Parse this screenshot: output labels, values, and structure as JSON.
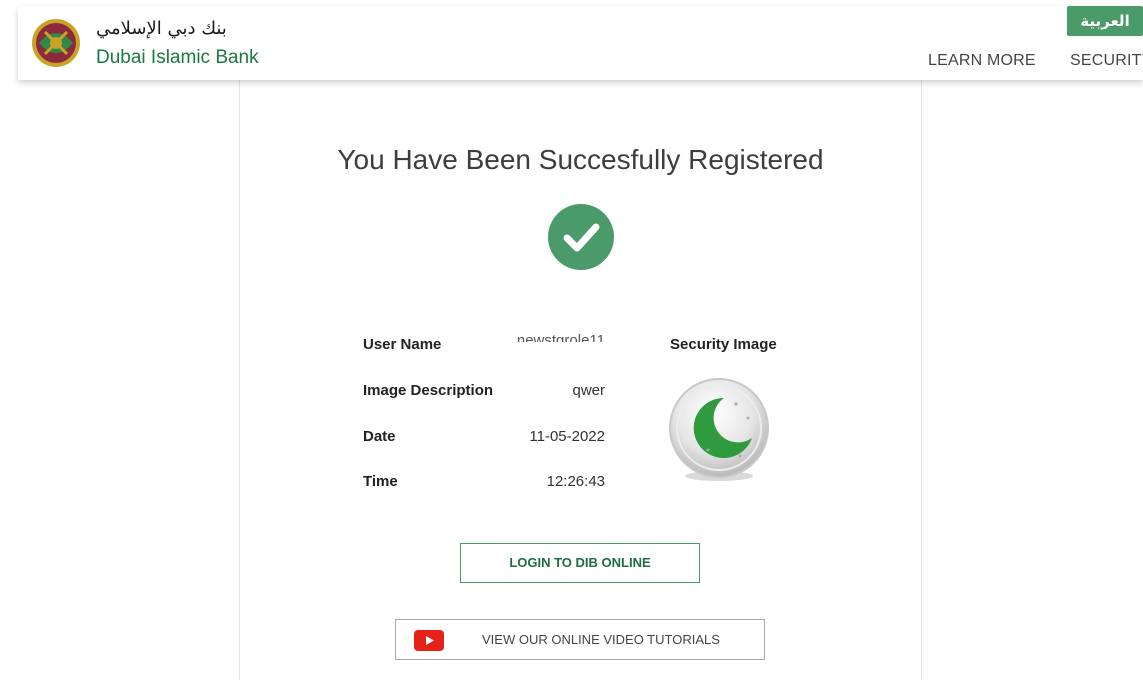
{
  "header": {
    "brand_ar": "بنك دبي الإسلامي",
    "brand_en": "Dubai Islamic Bank",
    "lang_toggle": "العربية",
    "nav": [
      "LEARN MORE",
      "SECURITY"
    ]
  },
  "main": {
    "title": "You Have Been Succesfully Registered",
    "fields": [
      {
        "label": "User Name",
        "value": "newstgrole11"
      },
      {
        "label": "Image Description",
        "value": "qwer"
      },
      {
        "label": "Date",
        "value": "11-05-2022"
      },
      {
        "label": "Time",
        "value": "12:26:43"
      }
    ],
    "security_image_label": "Security Image",
    "login_button": "LOGIN TO DIB ONLINE",
    "video_button": "VIEW OUR ONLINE VIDEO TUTORIALS"
  },
  "colors": {
    "brand_green": "#1a7a3e",
    "accent_green": "#4a9a6a",
    "youtube_red": "#e62117"
  },
  "icons": [
    "dib-logo-icon",
    "success-check-icon",
    "crescent-moon-icon",
    "youtube-icon"
  ]
}
